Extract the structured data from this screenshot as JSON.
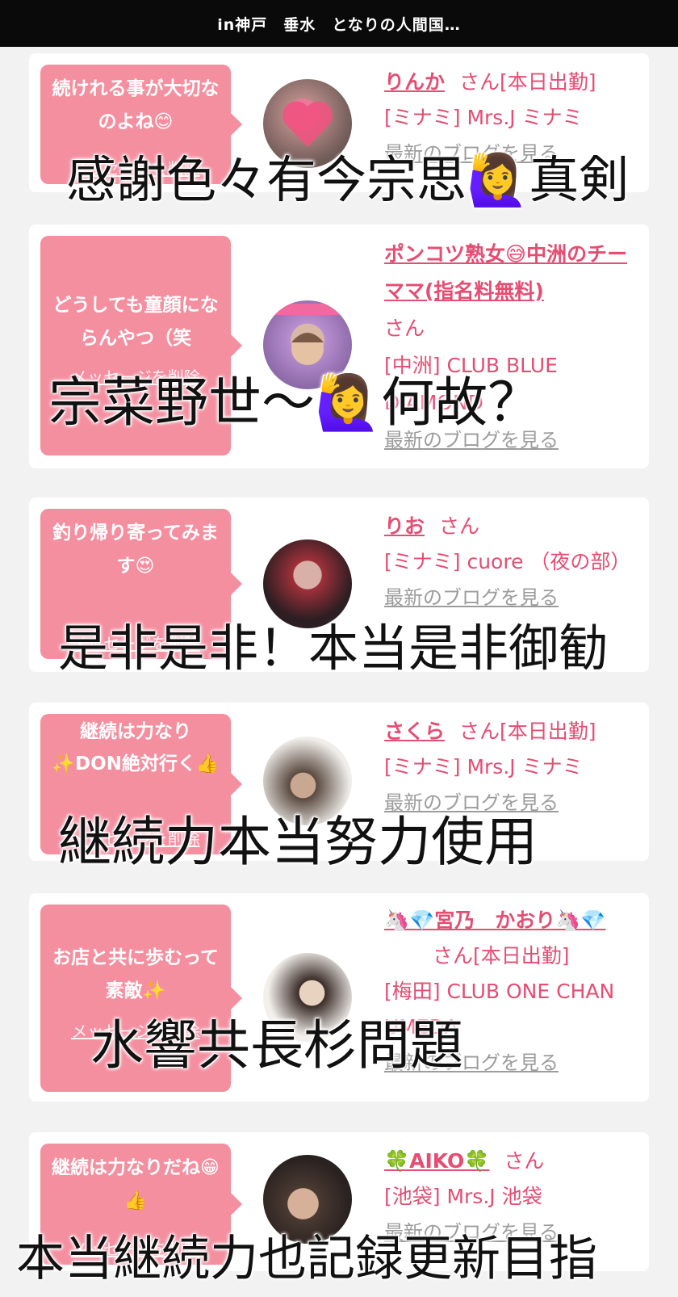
{
  "header": {
    "title": "in神戸　垂水　となりの人間国…"
  },
  "cards": [
    {
      "message": "続けれる事が大切なのよね😊",
      "delete_label": "メッセージを削除",
      "name": "りんか",
      "san": "さん[本日出勤]",
      "shop": "[ミナミ] Mrs.J ミナミ",
      "more": "最新のブログを見る",
      "caption": "感謝色々有今宗思🙋‍♀️真剣"
    },
    {
      "message": "どうしても童顔にならんやつ（笑",
      "delete_label": "メッセージを削除",
      "name": "ポンコツ熟女😅中洲のチーママ(指名料無料)",
      "san": "さん",
      "shop": "[中洲] CLUB BLUE DIAMOND",
      "more": "最新のブログを見る",
      "caption": "宗菜野世〜🙋‍♀️何故？"
    },
    {
      "message": "釣り帰り寄ってみます😍",
      "delete_label": "メッセージを削除",
      "name": "りお",
      "san": "さん",
      "shop": "[ミナミ] cuore （夜の部）",
      "more": "最新のブログを見る",
      "caption": "是非是非！本当是非御勧"
    },
    {
      "message": "継続は力なり✨DON絶対行く👍",
      "delete_label": "メッセージを削除",
      "name": "さくら",
      "san": "さん[本日出勤]",
      "shop": "[ミナミ] Mrs.J ミナミ",
      "more": "最新のブログを見る",
      "caption": "継続力本当努力使用"
    },
    {
      "message": "お店と共に歩むって素敵✨",
      "delete_label": "メッセージを削除",
      "name": "🦄💎宮乃　かおり🦄💎",
      "san": "さん[本日出勤]",
      "shop": "[梅田] CLUB ONE CHAN UMEDA",
      "more": "最新のブログを見る",
      "caption": "水響共長杉問題"
    },
    {
      "message": "継続は力なりだね😁👍",
      "delete_label": "メッセージを削除",
      "name": "🍀AIKO🍀",
      "san": "さん",
      "shop": "[池袋] Mrs.J 池袋",
      "more": "最新のブログを見る",
      "caption": "本当継続力也記録更新目指"
    }
  ],
  "colors": {
    "accent": "#e54d73",
    "bubble": "#f48fa0",
    "topbar": "#0a0a0a",
    "background": "#f2f2f2"
  }
}
